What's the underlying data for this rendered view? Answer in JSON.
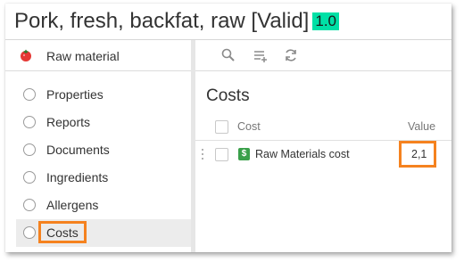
{
  "header": {
    "title": "Pork, fresh, backfat, raw [Valid]",
    "version": "1.0"
  },
  "sidebar": {
    "header_label": "Raw material",
    "header_icon": "tomato-icon",
    "items": [
      {
        "label": "Properties"
      },
      {
        "label": "Reports"
      },
      {
        "label": "Documents"
      },
      {
        "label": "Ingredients"
      },
      {
        "label": "Allergens"
      },
      {
        "label": "Costs",
        "active": true
      }
    ]
  },
  "toolbar": {
    "icons": [
      "search-icon",
      "add-list-icon",
      "refresh-icon"
    ]
  },
  "main": {
    "section_title": "Costs",
    "columns": {
      "cost": "Cost",
      "value": "Value"
    },
    "rows": [
      {
        "label": "Raw Materials cost",
        "icon": "dollar-icon",
        "icon_glyph": "$",
        "value": "2,1"
      }
    ]
  },
  "colors": {
    "highlight": "#f5821f",
    "version_badge": "#00e0a6",
    "cost_icon": "#3aa04a"
  }
}
